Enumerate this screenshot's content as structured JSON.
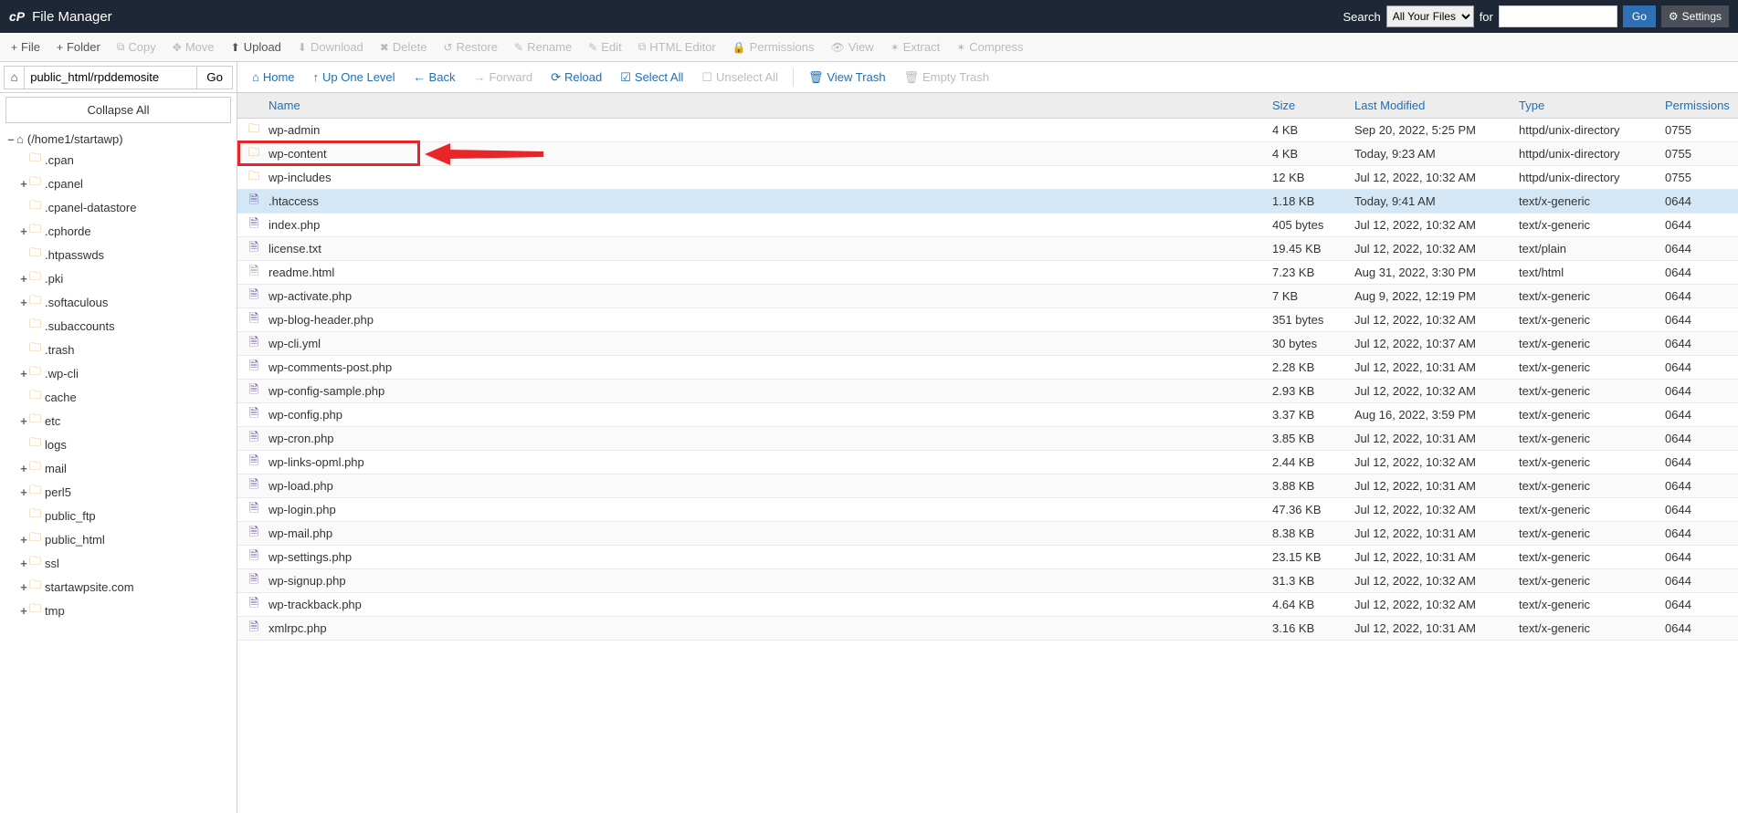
{
  "header": {
    "title": "File Manager",
    "search_label": "Search",
    "search_select": "All Your Files",
    "for_label": "for",
    "go": "Go",
    "settings": "Settings"
  },
  "toolbar": [
    {
      "icon": "+",
      "label": "File",
      "enabled": true
    },
    {
      "icon": "+",
      "label": "Folder",
      "enabled": true
    },
    {
      "icon": "⧉",
      "label": "Copy",
      "enabled": false
    },
    {
      "icon": "✥",
      "label": "Move",
      "enabled": false
    },
    {
      "icon": "⬆",
      "label": "Upload",
      "enabled": true
    },
    {
      "icon": "⬇",
      "label": "Download",
      "enabled": false
    },
    {
      "icon": "✖",
      "label": "Delete",
      "enabled": false
    },
    {
      "icon": "↺",
      "label": "Restore",
      "enabled": false
    },
    {
      "icon": "✎",
      "label": "Rename",
      "enabled": false
    },
    {
      "icon": "✎",
      "label": "Edit",
      "enabled": false
    },
    {
      "icon": "⧉",
      "label": "HTML Editor",
      "enabled": false
    },
    {
      "icon": "🔒",
      "label": "Permissions",
      "enabled": false
    },
    {
      "icon": "👁",
      "label": "View",
      "enabled": false
    },
    {
      "icon": "✶",
      "label": "Extract",
      "enabled": false
    },
    {
      "icon": "✶",
      "label": "Compress",
      "enabled": false
    }
  ],
  "path": {
    "value": "public_html/rpddemosite",
    "go": "Go"
  },
  "collapse_all": "Collapse All",
  "tree": [
    {
      "indent": 0,
      "toggle": "–",
      "home": true,
      "label": "(/home1/startawp)"
    },
    {
      "indent": 1,
      "toggle": "",
      "label": ".cpan"
    },
    {
      "indent": 1,
      "toggle": "+",
      "label": ".cpanel"
    },
    {
      "indent": 1,
      "toggle": "",
      "label": ".cpanel-datastore"
    },
    {
      "indent": 1,
      "toggle": "+",
      "label": ".cphorde"
    },
    {
      "indent": 1,
      "toggle": "",
      "label": ".htpasswds"
    },
    {
      "indent": 1,
      "toggle": "+",
      "label": ".pki"
    },
    {
      "indent": 1,
      "toggle": "+",
      "label": ".softaculous"
    },
    {
      "indent": 1,
      "toggle": "",
      "label": ".subaccounts"
    },
    {
      "indent": 1,
      "toggle": "",
      "label": ".trash"
    },
    {
      "indent": 1,
      "toggle": "+",
      "label": ".wp-cli"
    },
    {
      "indent": 1,
      "toggle": "",
      "label": "cache"
    },
    {
      "indent": 1,
      "toggle": "+",
      "label": "etc"
    },
    {
      "indent": 1,
      "toggle": "",
      "label": "logs"
    },
    {
      "indent": 1,
      "toggle": "+",
      "label": "mail"
    },
    {
      "indent": 1,
      "toggle": "+",
      "label": "perl5"
    },
    {
      "indent": 1,
      "toggle": "",
      "label": "public_ftp"
    },
    {
      "indent": 1,
      "toggle": "+",
      "label": "public_html"
    },
    {
      "indent": 1,
      "toggle": "+",
      "label": "ssl"
    },
    {
      "indent": 1,
      "toggle": "+",
      "label": "startawpsite.com"
    },
    {
      "indent": 1,
      "toggle": "+",
      "label": "tmp"
    }
  ],
  "nav": [
    {
      "icon": "⌂",
      "label": "Home",
      "enabled": true
    },
    {
      "icon": "↑",
      "label": "Up One Level",
      "enabled": true
    },
    {
      "icon": "←",
      "label": "Back",
      "enabled": true
    },
    {
      "icon": "→",
      "label": "Forward",
      "enabled": false
    },
    {
      "icon": "⟳",
      "label": "Reload",
      "enabled": true
    },
    {
      "icon": "☑",
      "label": "Select All",
      "enabled": true
    },
    {
      "icon": "☐",
      "label": "Unselect All",
      "enabled": false
    },
    {
      "sep": true
    },
    {
      "icon": "🗑",
      "label": "View Trash",
      "enabled": true
    },
    {
      "icon": "🗑",
      "label": "Empty Trash",
      "enabled": false
    }
  ],
  "columns": {
    "name": "Name",
    "size": "Size",
    "modified": "Last Modified",
    "type": "Type",
    "perms": "Permissions"
  },
  "files": [
    {
      "icon": "folder",
      "name": "wp-admin",
      "size": "4 KB",
      "modified": "Sep 20, 2022, 5:25 PM",
      "type": "httpd/unix-directory",
      "perms": "0755"
    },
    {
      "icon": "folder",
      "name": "wp-content",
      "size": "4 KB",
      "modified": "Today, 9:23 AM",
      "type": "httpd/unix-directory",
      "perms": "0755",
      "highlighted": true
    },
    {
      "icon": "folder",
      "name": "wp-includes",
      "size": "12 KB",
      "modified": "Jul 12, 2022, 10:32 AM",
      "type": "httpd/unix-directory",
      "perms": "0755"
    },
    {
      "icon": "file",
      "name": ".htaccess",
      "size": "1.18 KB",
      "modified": "Today, 9:41 AM",
      "type": "text/x-generic",
      "perms": "0644",
      "selected": true
    },
    {
      "icon": "file",
      "name": "index.php",
      "size": "405 bytes",
      "modified": "Jul 12, 2022, 10:32 AM",
      "type": "text/x-generic",
      "perms": "0644"
    },
    {
      "icon": "file",
      "name": "license.txt",
      "size": "19.45 KB",
      "modified": "Jul 12, 2022, 10:32 AM",
      "type": "text/plain",
      "perms": "0644"
    },
    {
      "icon": "doc",
      "name": "readme.html",
      "size": "7.23 KB",
      "modified": "Aug 31, 2022, 3:30 PM",
      "type": "text/html",
      "perms": "0644"
    },
    {
      "icon": "file",
      "name": "wp-activate.php",
      "size": "7 KB",
      "modified": "Aug 9, 2022, 12:19 PM",
      "type": "text/x-generic",
      "perms": "0644"
    },
    {
      "icon": "file",
      "name": "wp-blog-header.php",
      "size": "351 bytes",
      "modified": "Jul 12, 2022, 10:32 AM",
      "type": "text/x-generic",
      "perms": "0644"
    },
    {
      "icon": "file",
      "name": "wp-cli.yml",
      "size": "30 bytes",
      "modified": "Jul 12, 2022, 10:37 AM",
      "type": "text/x-generic",
      "perms": "0644"
    },
    {
      "icon": "file",
      "name": "wp-comments-post.php",
      "size": "2.28 KB",
      "modified": "Jul 12, 2022, 10:31 AM",
      "type": "text/x-generic",
      "perms": "0644"
    },
    {
      "icon": "file",
      "name": "wp-config-sample.php",
      "size": "2.93 KB",
      "modified": "Jul 12, 2022, 10:32 AM",
      "type": "text/x-generic",
      "perms": "0644"
    },
    {
      "icon": "file",
      "name": "wp-config.php",
      "size": "3.37 KB",
      "modified": "Aug 16, 2022, 3:59 PM",
      "type": "text/x-generic",
      "perms": "0644"
    },
    {
      "icon": "file",
      "name": "wp-cron.php",
      "size": "3.85 KB",
      "modified": "Jul 12, 2022, 10:31 AM",
      "type": "text/x-generic",
      "perms": "0644"
    },
    {
      "icon": "file",
      "name": "wp-links-opml.php",
      "size": "2.44 KB",
      "modified": "Jul 12, 2022, 10:32 AM",
      "type": "text/x-generic",
      "perms": "0644"
    },
    {
      "icon": "file",
      "name": "wp-load.php",
      "size": "3.88 KB",
      "modified": "Jul 12, 2022, 10:31 AM",
      "type": "text/x-generic",
      "perms": "0644"
    },
    {
      "icon": "file",
      "name": "wp-login.php",
      "size": "47.36 KB",
      "modified": "Jul 12, 2022, 10:32 AM",
      "type": "text/x-generic",
      "perms": "0644"
    },
    {
      "icon": "file",
      "name": "wp-mail.php",
      "size": "8.38 KB",
      "modified": "Jul 12, 2022, 10:31 AM",
      "type": "text/x-generic",
      "perms": "0644"
    },
    {
      "icon": "file",
      "name": "wp-settings.php",
      "size": "23.15 KB",
      "modified": "Jul 12, 2022, 10:31 AM",
      "type": "text/x-generic",
      "perms": "0644"
    },
    {
      "icon": "file",
      "name": "wp-signup.php",
      "size": "31.3 KB",
      "modified": "Jul 12, 2022, 10:32 AM",
      "type": "text/x-generic",
      "perms": "0644"
    },
    {
      "icon": "file",
      "name": "wp-trackback.php",
      "size": "4.64 KB",
      "modified": "Jul 12, 2022, 10:32 AM",
      "type": "text/x-generic",
      "perms": "0644"
    },
    {
      "icon": "file",
      "name": "xmlrpc.php",
      "size": "3.16 KB",
      "modified": "Jul 12, 2022, 10:31 AM",
      "type": "text/x-generic",
      "perms": "0644"
    }
  ]
}
